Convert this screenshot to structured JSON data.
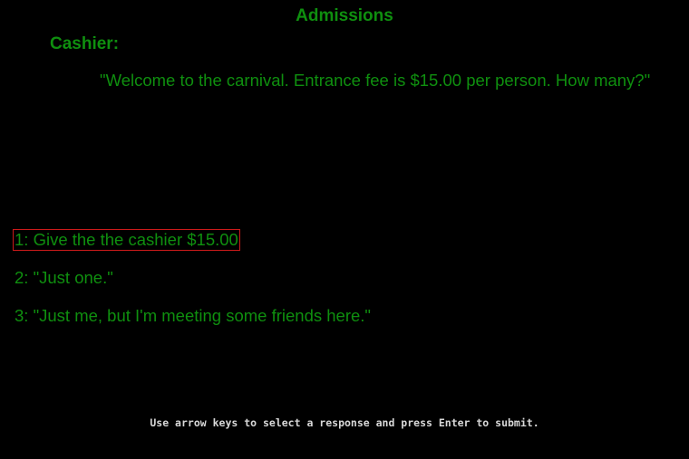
{
  "header": {
    "title": "Admissions"
  },
  "dialogue": {
    "speaker": "Cashier:",
    "text": "\"Welcome to the carnival. Entrance fee is $15.00 per person. How many?\""
  },
  "options": [
    {
      "label": "1: Give the the cashier $15.00",
      "selected": true
    },
    {
      "label": "2: \"Just one.\"",
      "selected": false
    },
    {
      "label": "3: \"Just me, but I'm meeting some friends here.\"",
      "selected": false
    }
  ],
  "footer": {
    "hint": "Use arrow keys to select a response and press Enter to submit."
  },
  "colors": {
    "background": "#000000",
    "text": "#0f8f0f",
    "selection_border": "#cc1a1a",
    "hint_text": "#d8d8d8"
  }
}
